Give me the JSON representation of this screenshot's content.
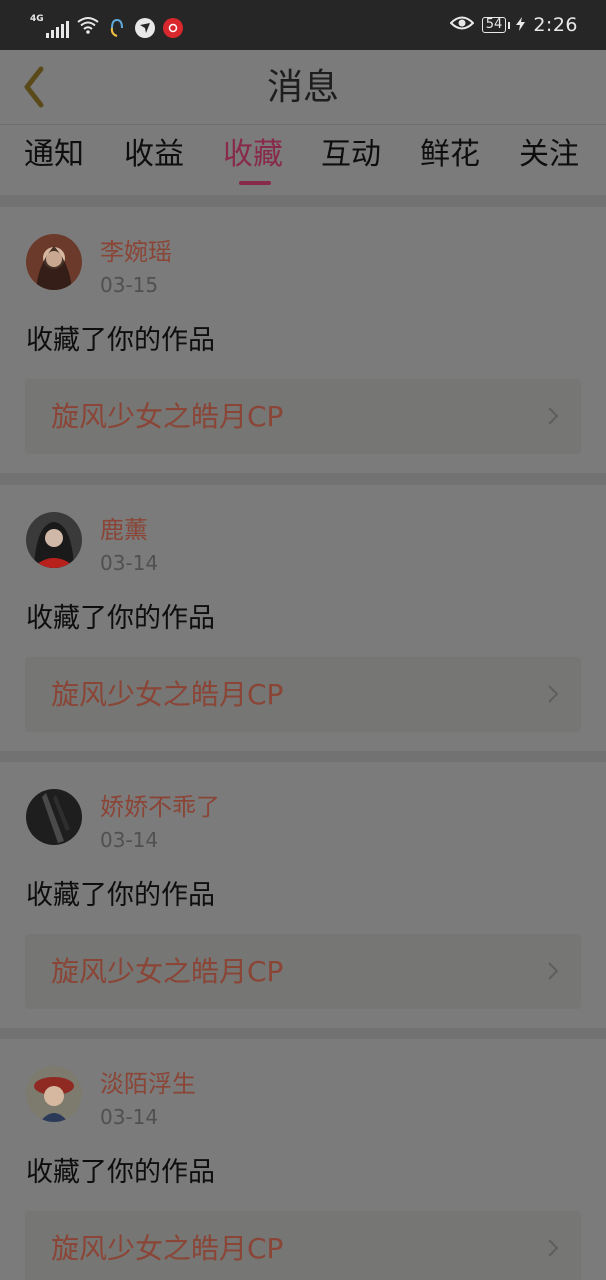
{
  "status_bar": {
    "network": "4G",
    "battery": "54",
    "time": "2:26",
    "icons": [
      "signal-icon",
      "wifi-icon",
      "headset-app-icon",
      "bird-app-icon",
      "netease-music-icon",
      "eye-icon",
      "charging-bolt-icon"
    ]
  },
  "header": {
    "title": "消息",
    "back_icon": "chevron-left-icon"
  },
  "tabs": [
    {
      "label": "通知"
    },
    {
      "label": "收益"
    },
    {
      "label": "收藏"
    },
    {
      "label": "互动"
    },
    {
      "label": "鲜花"
    },
    {
      "label": "关注"
    }
  ],
  "active_tab": "收藏",
  "colors": {
    "accent": "#882b4b",
    "name_text": "#8a4536",
    "status_bar_bg": "#262626",
    "page_bg": "#7b7b7b"
  },
  "messages": [
    {
      "user": "李婉瑶",
      "date": "03-15",
      "action": "收藏了你的作品",
      "work": "旋风少女之皓月CP"
    },
    {
      "user": "鹿薰",
      "date": "03-14",
      "action": "收藏了你的作品",
      "work": "旋风少女之皓月CP"
    },
    {
      "user": "娇娇不乖了",
      "date": "03-14",
      "action": "收藏了你的作品",
      "work": "旋风少女之皓月CP"
    },
    {
      "user": "淡陌浮生",
      "date": "03-14",
      "action": "收藏了你的作品",
      "work": "旋风少女之皓月CP"
    }
  ]
}
